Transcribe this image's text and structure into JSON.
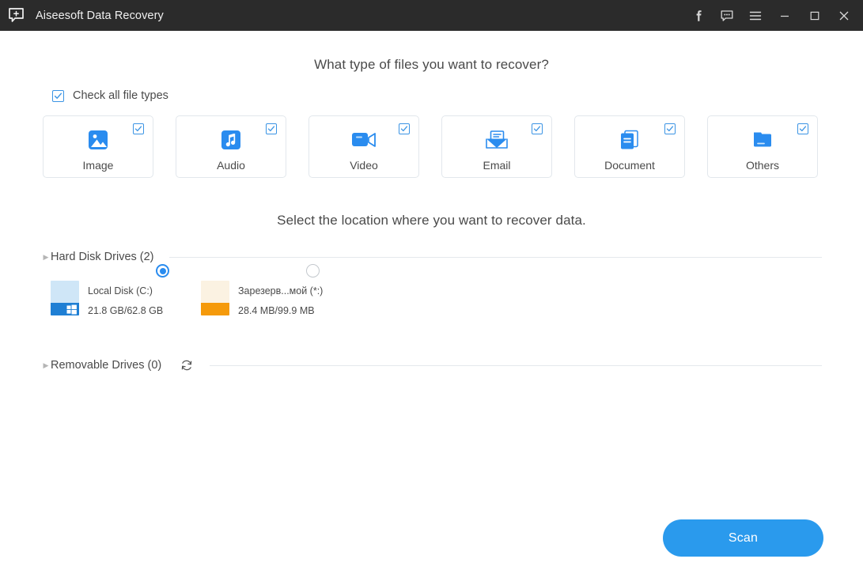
{
  "titlebar": {
    "app_title": "Aiseesoft Data Recovery",
    "logo_icon": "app-plus-bubble-icon",
    "buttons": [
      {
        "name": "facebook",
        "icon": "facebook-icon",
        "label": "f"
      },
      {
        "name": "feedback",
        "icon": "chat-bubble-icon",
        "label": ""
      },
      {
        "name": "menu",
        "icon": "hamburger-menu-icon",
        "label": ""
      },
      {
        "name": "minimize",
        "icon": "minimize-icon",
        "label": ""
      },
      {
        "name": "maximize",
        "icon": "maximize-icon",
        "label": ""
      },
      {
        "name": "close",
        "icon": "close-icon",
        "label": ""
      }
    ]
  },
  "filetypes": {
    "heading": "What type of files you want to recover?",
    "check_all_label": "Check all file types",
    "check_all_checked": true,
    "items": [
      {
        "label": "Image",
        "icon": "image-icon",
        "checked": true
      },
      {
        "label": "Audio",
        "icon": "audio-icon",
        "checked": true
      },
      {
        "label": "Video",
        "icon": "video-icon",
        "checked": true
      },
      {
        "label": "Email",
        "icon": "email-icon",
        "checked": true
      },
      {
        "label": "Document",
        "icon": "document-icon",
        "checked": true
      },
      {
        "label": "Others",
        "icon": "folder-icon",
        "checked": true
      }
    ]
  },
  "location": {
    "heading": "Select the location where you want to recover data.",
    "hard_disk_section": "Hard Disk Drives (2)",
    "removable_section": "Removable Drives (0)",
    "refresh_icon": "refresh-icon",
    "drives": [
      {
        "name": "Local Disk (C:)",
        "size": "21.8 GB/62.8 GB",
        "selected": true,
        "icon": "windows-drive-icon",
        "bar_color": "#1f7fd4",
        "track_color": "#cfe6f7"
      },
      {
        "name": "Зарезерв...мой (*:)",
        "size": "28.4 MB/99.9 MB",
        "selected": false,
        "icon": "drive-icon",
        "bar_color": "#f59a0b",
        "track_color": "#fbf2e2"
      }
    ]
  },
  "footer": {
    "scan_label": "Scan"
  },
  "colors": {
    "accent": "#2a9aed",
    "titlebar_bg": "#2b2b2b",
    "text": "#4a4a4a",
    "orange": "#f59a0b"
  }
}
